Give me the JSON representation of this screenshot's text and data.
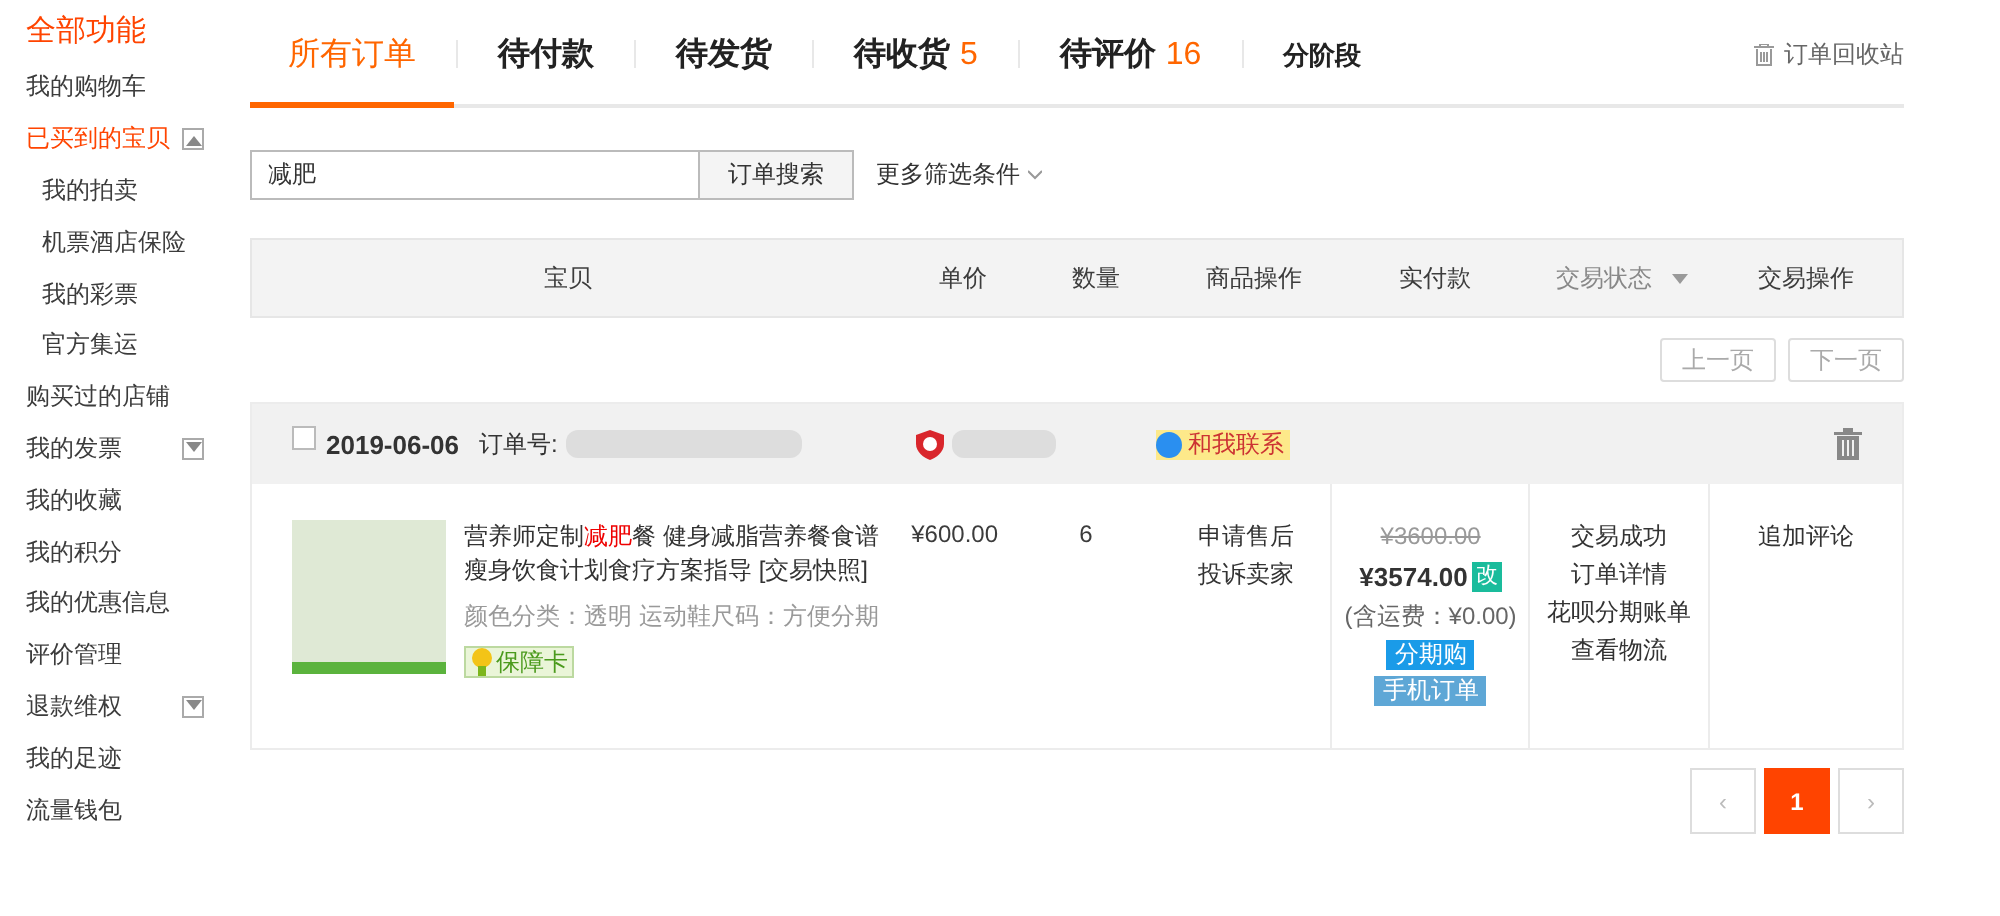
{
  "sidebar": {
    "title": "全部功能",
    "items": [
      {
        "label": "我的购物车",
        "selected": false
      },
      {
        "label": "已买到的宝贝",
        "selected": true,
        "expanded": true,
        "children": [
          {
            "label": "我的拍卖",
            "selected": false
          },
          {
            "label": "机票酒店保险",
            "selected": false
          },
          {
            "label": "我的彩票",
            "selected": false
          },
          {
            "label": "官方集运",
            "selected": false
          }
        ]
      },
      {
        "label": "购买过的店铺",
        "selected": false
      },
      {
        "label": "我的发票",
        "selected": false,
        "expanded": false
      },
      {
        "label": "我的收藏",
        "selected": false
      },
      {
        "label": "我的积分",
        "selected": false
      },
      {
        "label": "我的优惠信息",
        "selected": false
      },
      {
        "label": "评价管理",
        "selected": false
      },
      {
        "label": "退款维权",
        "selected": false,
        "expanded": false
      },
      {
        "label": "我的足迹",
        "selected": false
      },
      {
        "label": "流量钱包",
        "selected": false
      }
    ]
  },
  "tabs": [
    {
      "label": "所有订单",
      "selected": true,
      "kind": "main"
    },
    {
      "label": "待付款",
      "selected": false,
      "kind": "main"
    },
    {
      "label": "待发货",
      "selected": false,
      "kind": "main"
    },
    {
      "label": "待收货",
      "count": "5",
      "selected": false,
      "kind": "main"
    },
    {
      "label": "待评价",
      "count": "16",
      "selected": false,
      "kind": "main"
    },
    {
      "label": "分阶段",
      "selected": false,
      "kind": "small"
    }
  ],
  "recycle_bin": "订单回收站",
  "search": {
    "value": "减肥",
    "button": "订单搜索",
    "more_filters": "更多筛选条件"
  },
  "table": {
    "columns": [
      "宝贝",
      "单价",
      "数量",
      "商品操作",
      "实付款",
      "交易状态",
      "交易操作"
    ]
  },
  "pager_top": {
    "prev": "上一页",
    "next": "下一页",
    "disabled": true
  },
  "order": {
    "checked": false,
    "date": "2019-06-06",
    "number_label": "订单号:",
    "contact": "和我联系",
    "product": {
      "title_parts": [
        {
          "text": "营养师定制",
          "highlight": false
        },
        {
          "text": "减肥",
          "highlight": true
        },
        {
          "text": "餐 健身减脂营养餐食谱瘦身饮食计划食疗方案指导",
          "highlight": false
        }
      ],
      "snapshot": "[交易快照]",
      "spec": "颜色分类：透明  运动鞋尺码：方便分期",
      "badge": "保障卡"
    },
    "unit_price": "¥600.00",
    "quantity": "6",
    "item_actions": [
      "申请售后",
      "投诉卖家"
    ],
    "original_total": "¥3600.00",
    "paid": "¥3574.00",
    "modified_tag": "改",
    "shipping": "(含运费：¥0.00)",
    "tags": [
      {
        "label": "分期购",
        "color": "#1a9be8"
      },
      {
        "label": "手机订单",
        "color": "#5ea7d6"
      }
    ],
    "status_links": [
      "交易成功",
      "订单详情",
      "花呗分期账单",
      "查看物流"
    ],
    "order_actions": [
      "追加评论"
    ]
  },
  "pagination": {
    "prev": "‹",
    "next": "›",
    "pages": [
      {
        "label": "1",
        "selected": true
      }
    ]
  }
}
